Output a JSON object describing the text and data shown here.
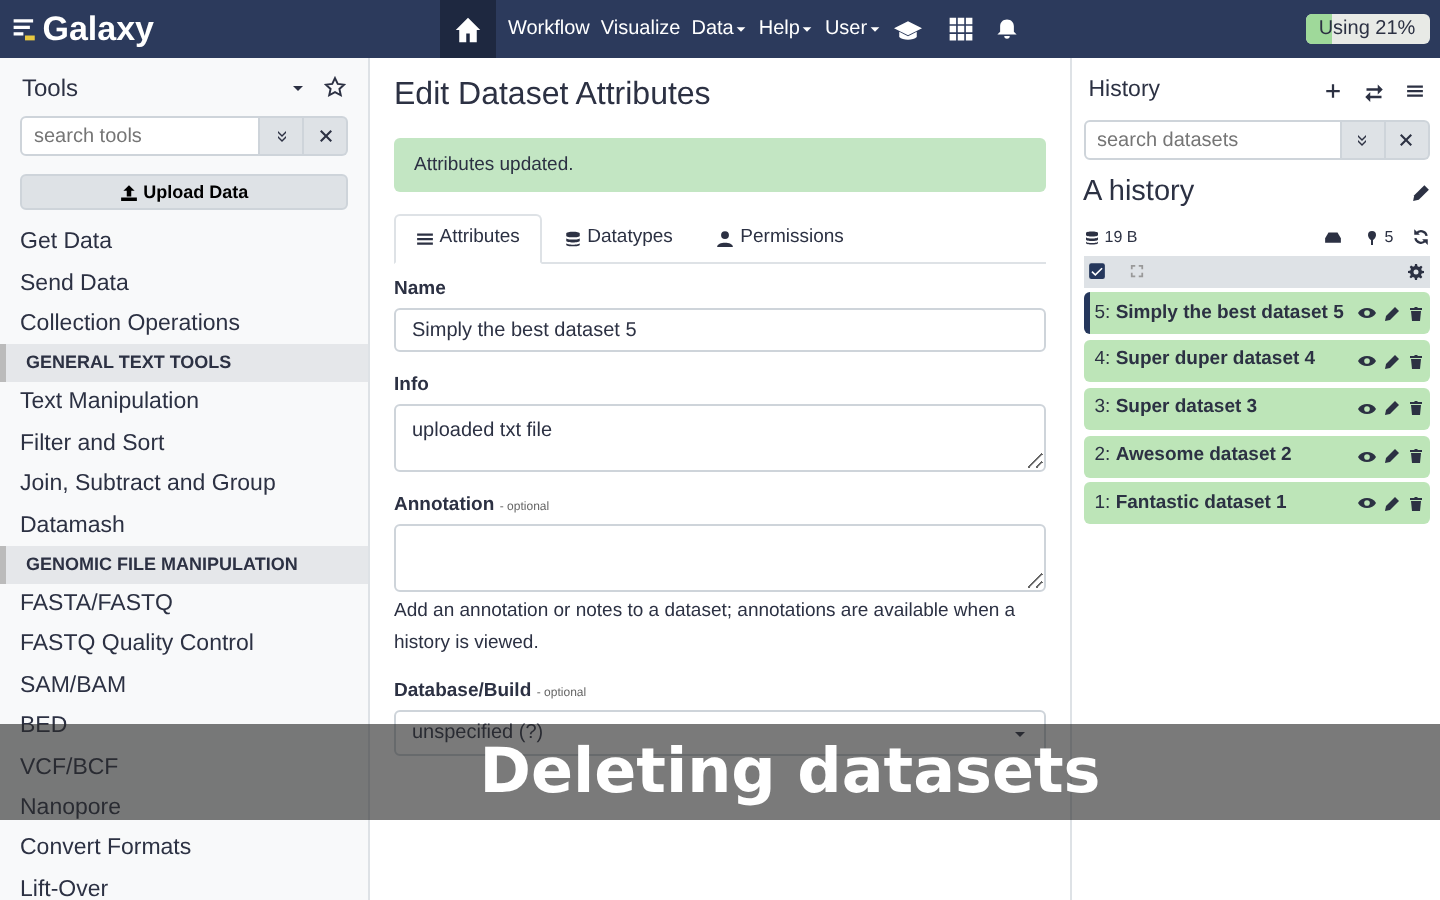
{
  "navbar": {
    "brand": "Galaxy",
    "items": [
      {
        "label": "Workflow",
        "dropdown": false
      },
      {
        "label": "Visualize",
        "dropdown": false
      },
      {
        "label": "Data",
        "dropdown": true
      },
      {
        "label": "Help",
        "dropdown": true
      },
      {
        "label": "User",
        "dropdown": true
      }
    ],
    "quota": {
      "label": "Using 21%",
      "level": 0.21
    }
  },
  "tools": {
    "title": "Tools",
    "search": {
      "placeholder": "search tools"
    },
    "upload": "Upload Data",
    "items": [
      {
        "kind": "tool",
        "label": "Get Data"
      },
      {
        "kind": "tool",
        "label": "Send Data"
      },
      {
        "kind": "tool",
        "label": "Collection Operations"
      },
      {
        "kind": "section",
        "label": "GENERAL TEXT TOOLS"
      },
      {
        "kind": "tool",
        "label": "Text Manipulation"
      },
      {
        "kind": "tool",
        "label": "Filter and Sort"
      },
      {
        "kind": "tool",
        "label": "Join, Subtract and Group"
      },
      {
        "kind": "tool",
        "label": "Datamash"
      },
      {
        "kind": "section",
        "label": "GENOMIC FILE MANIPULATION"
      },
      {
        "kind": "tool",
        "label": "FASTA/FASTQ"
      },
      {
        "kind": "tool",
        "label": "FASTQ Quality Control"
      },
      {
        "kind": "tool",
        "label": "SAM/BAM"
      },
      {
        "kind": "tool",
        "label": "BED"
      },
      {
        "kind": "tool",
        "label": "VCF/BCF"
      },
      {
        "kind": "tool",
        "label": "Nanopore"
      },
      {
        "kind": "tool",
        "label": "Convert Formats"
      },
      {
        "kind": "tool",
        "label": "Lift-Over"
      }
    ]
  },
  "editor": {
    "title": "Edit Dataset Attributes",
    "alert": "Attributes updated.",
    "tabs": [
      {
        "label": "Attributes",
        "selected": true
      },
      {
        "label": "Datatypes",
        "selected": false
      },
      {
        "label": "Permissions",
        "selected": false
      }
    ],
    "fields": [
      {
        "kind": "input",
        "label": "Name",
        "value": "Simply the best dataset 5"
      },
      {
        "kind": "textarea",
        "label": "Info",
        "value": "uploaded txt file"
      },
      {
        "kind": "textarea",
        "label": "Annotation",
        "optional": "- optional",
        "help": "Add an annotation or notes to a dataset; annotations are available when a history is viewed."
      },
      {
        "kind": "select",
        "label": "Database/Build",
        "optional": "- optional",
        "value": "unspecified (?)"
      }
    ]
  },
  "history": {
    "title": "History",
    "search": {
      "placeholder": "search datasets"
    },
    "name": "A history",
    "size": "19 B",
    "count": "5",
    "select_all_checked": true,
    "datasets": [
      {
        "label": "5: **Simply the best dataset 5**",
        "focused": true
      },
      {
        "label": "4: **Super duper dataset 4**",
        "focused": false
      },
      {
        "label": "3: **Super dataset 3**",
        "focused": false
      },
      {
        "label": "2: **Awesome dataset 2**",
        "focused": false
      },
      {
        "label": "1: **Fantastic dataset 1**",
        "focused": false
      }
    ]
  },
  "caption": "Deleting datasets"
}
